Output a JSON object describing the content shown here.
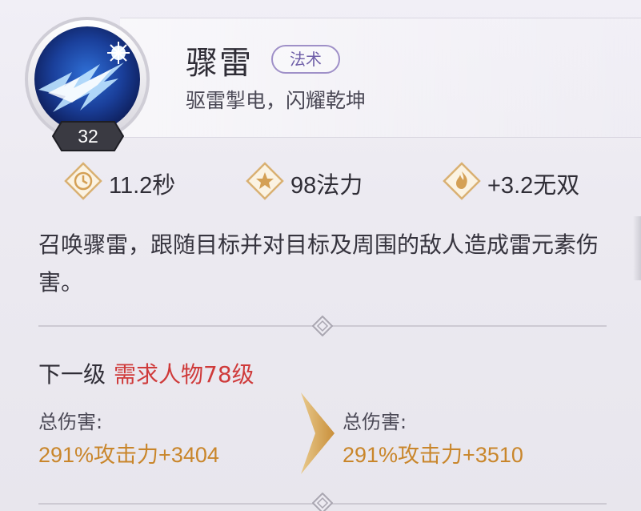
{
  "skill": {
    "name": "骤雷",
    "type_tag": "法术",
    "subtitle": "驱雷掣电，闪耀乾坤",
    "level": "32",
    "icon": "lightning-skill-icon"
  },
  "stats": {
    "cooldown": "11.2秒",
    "mana": "98法力",
    "bonus": "+3.2无双"
  },
  "description": "召唤骤雷，跟随目标并对目标及周围的敌人造成雷元素伤害。",
  "next_level": {
    "label": "下一级",
    "requirement": "需求人物78级"
  },
  "damage": {
    "current_label": "总伤害:",
    "current_value": "291%攻击力+3404",
    "next_label": "总伤害:",
    "next_value": "291%攻击力+3510"
  },
  "colors": {
    "accent_gold": "#c9862b",
    "requirement_red": "#cf3a3a",
    "tag_purple": "#9f90c8"
  }
}
